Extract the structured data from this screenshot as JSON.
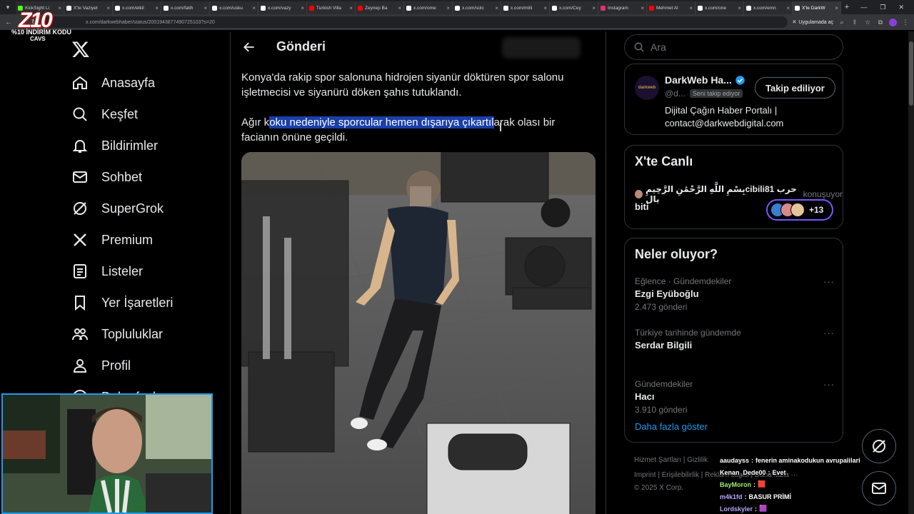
{
  "browser": {
    "tabs": [
      {
        "title": "KickSight Li",
        "color": "#53fc18"
      },
      {
        "title": "X'te Vaziyet",
        "color": "#ffffff"
      },
      {
        "title": "x.com/etkil",
        "color": "#ffffff"
      },
      {
        "title": "x.com/fatih",
        "color": "#ffffff"
      },
      {
        "title": "x.com/usku",
        "color": "#ffffff"
      },
      {
        "title": "x.com/vazy",
        "color": "#ffffff"
      },
      {
        "title": "Turkish Villa",
        "color": "#ff0000"
      },
      {
        "title": "Zeynep Ba",
        "color": "#ff0000"
      },
      {
        "title": "x.com/ome",
        "color": "#ffffff"
      },
      {
        "title": "x.com/solc",
        "color": "#ffffff"
      },
      {
        "title": "x.com/milli",
        "color": "#ffffff"
      },
      {
        "title": "x.com/Cey",
        "color": "#ffffff"
      },
      {
        "title": "Instagram",
        "color": "#e1306c"
      },
      {
        "title": "Mehmet Al",
        "color": "#ff0000"
      },
      {
        "title": "x.com/one",
        "color": "#ffffff"
      },
      {
        "title": "x.com/emn",
        "color": "#ffffff"
      },
      {
        "title": "X'te DarkW",
        "color": "#ffffff"
      }
    ],
    "url": "x.com/darkwebhaber/status/2001943877490725103?s=20",
    "app_chip": "Uygulamada aç"
  },
  "overlay": {
    "logo_text": "Z10",
    "promo_line1": "%10 İNDİRİM KODU",
    "promo_line2": "CAVS"
  },
  "nav": {
    "items": [
      {
        "label": "Anasayfa",
        "icon": "home-icon"
      },
      {
        "label": "Keşfet",
        "icon": "search-icon"
      },
      {
        "label": "Bildirimler",
        "icon": "bell-icon"
      },
      {
        "label": "Sohbet",
        "icon": "mail-icon"
      },
      {
        "label": "SuperGrok",
        "icon": "grok-icon"
      },
      {
        "label": "Premium",
        "icon": "x-icon"
      },
      {
        "label": "Listeler",
        "icon": "list-icon"
      },
      {
        "label": "Yer İşaretleri",
        "icon": "bookmark-icon"
      },
      {
        "label": "Topluluklar",
        "icon": "communities-icon"
      },
      {
        "label": "Profil",
        "icon": "profile-icon"
      },
      {
        "label": "Daha fazla",
        "icon": "more-icon"
      }
    ]
  },
  "post": {
    "header_title": "Gönderi",
    "paragraph1": "Konya'da rakip spor salonuna hidrojen siyanür döktüren spor salonu işletmecisi ve siyanürü döken şahıs tutuklandı.",
    "p2_before": "Ağır k",
    "p2_highlight": "oku nedeniyle sporcular hemen dışarıya çıkartıl",
    "p2_after": "arak olası bir facianın önüne geçildi."
  },
  "search": {
    "placeholder": "Ara"
  },
  "account": {
    "name": "DarkWeb Ha...",
    "handle": "@d...",
    "follows_you": "Seni takip ediyor",
    "follow_button": "Takip ediliyor",
    "bio_line1": "Dijital Çağın Haber Portalı |",
    "bio_line2": "contact@darkwebdigital.com",
    "avatar_text": "darkweb"
  },
  "live": {
    "title": "X'te Canlı",
    "user": "بِسْمِ اللَّهِ الرَّحْمَٰنِ الرَّحِيمِcibili81 حرب يال",
    "talking": "konuşuyor",
    "topic": "biti",
    "count": "+13"
  },
  "trends": {
    "title": "Neler oluyor?",
    "items": [
      {
        "context": "Eğlence · Gündemdekiler",
        "name": "Ezgi Eyüboğlu",
        "posts": "2.473 gönderi"
      },
      {
        "context": "Türkiye tarihinde gündemde",
        "name": "Serdar Bilgili",
        "posts": ""
      },
      {
        "context": "Gündemdekiler",
        "name": "Hacı",
        "posts": "3.910 gönderi"
      }
    ],
    "show_more": "Daha fazla göster"
  },
  "footer": {
    "line1": "Hizmet Şartları  |  Gizlilik",
    "line2": "Imprint  |  Erişilebilirlik  |  Reklam bilgisi  |  Daha fazla ···",
    "line3": "© 2025 X Corp."
  },
  "chat": [
    {
      "user": "aaudayss",
      "msg": "fenerin aminakodukun avrupalilari",
      "color": "#ffffff"
    },
    {
      "user": "Kenan_Dede00",
      "msg": "Evet",
      "color": "#ffffff"
    },
    {
      "user": "BayMoron",
      "msg": "🟥",
      "color": "#9cf26e"
    },
    {
      "user": "m4k1fd",
      "msg": "BASUR PRİMİ",
      "color": "#b9a4ff"
    },
    {
      "user": "Lordskyler",
      "msg": "🟪",
      "color": "#b9a4ff"
    }
  ],
  "colors": {
    "accent": "#1d9bf0",
    "highlight": "#1a3fa8",
    "border": "#2f3336",
    "muted": "#71767b"
  }
}
